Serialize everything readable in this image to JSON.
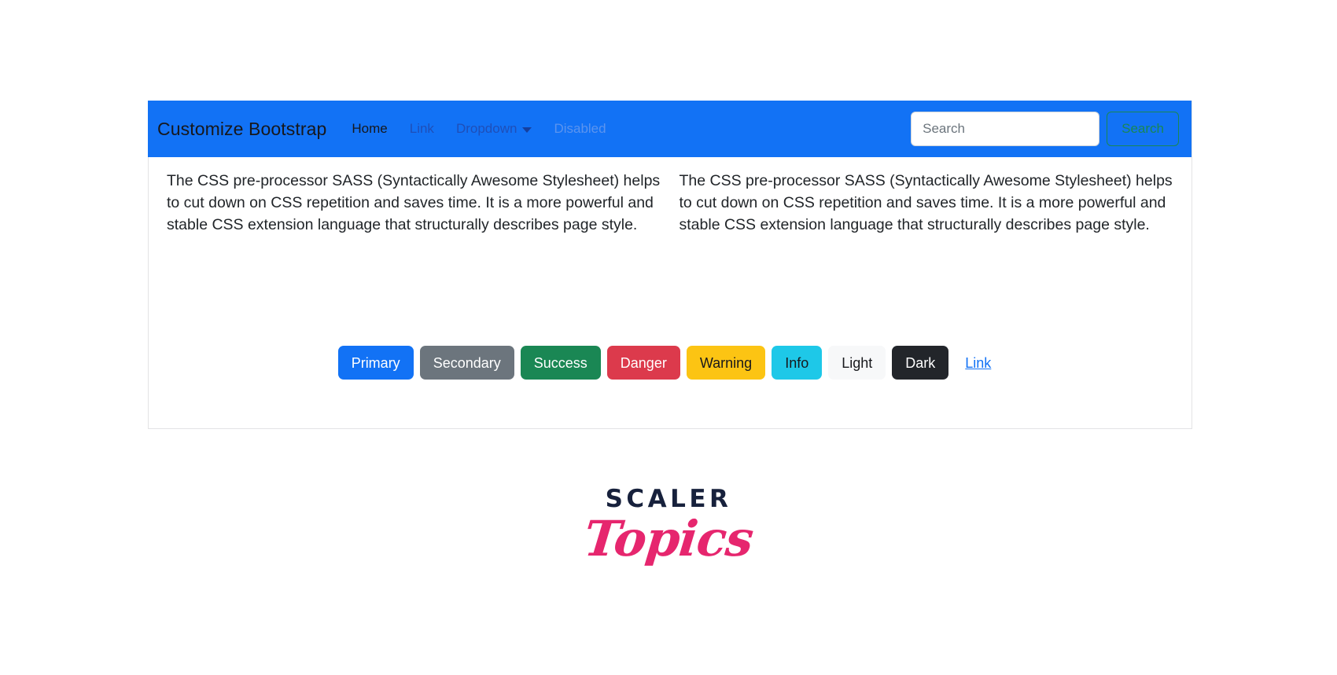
{
  "navbar": {
    "brand": "Customize Bootstrap",
    "background_color": "#1272f5",
    "links": [
      {
        "label": "Home",
        "state": "active"
      },
      {
        "label": "Link",
        "state": "default"
      },
      {
        "label": "Dropdown",
        "state": "dropdown"
      },
      {
        "label": "Disabled",
        "state": "disabled"
      }
    ],
    "dropdown_caret_icon": "caret-down-icon",
    "search": {
      "placeholder": "Search",
      "value": "",
      "button_label": "Search",
      "button_color": "#198754"
    }
  },
  "content": {
    "columns": [
      {
        "paragraph": "The CSS pre-processor SASS (Syntactically Awesome Stylesheet) helps to cut down on CSS repetition and saves time. It is a more powerful and stable CSS extension language that structurally describes page style."
      },
      {
        "paragraph": "The CSS pre-processor SASS (Syntactically Awesome Stylesheet) helps to cut down on CSS repetition and saves time. It is a more powerful and stable CSS extension language that structurally describes page style."
      }
    ],
    "buttons": [
      {
        "label": "Primary",
        "variant": "primary",
        "color": "#1272f5"
      },
      {
        "label": "Secondary",
        "variant": "secondary",
        "color": "#6c757d"
      },
      {
        "label": "Success",
        "variant": "success",
        "color": "#1a8754"
      },
      {
        "label": "Danger",
        "variant": "danger",
        "color": "#dc3a4c"
      },
      {
        "label": "Warning",
        "variant": "warning",
        "color": "#fcc413"
      },
      {
        "label": "Info",
        "variant": "info",
        "color": "#1ec8e8"
      },
      {
        "label": "Light",
        "variant": "light",
        "color": "#f7f8f9"
      },
      {
        "label": "Dark",
        "variant": "dark",
        "color": "#22252a"
      },
      {
        "label": "Link",
        "variant": "link",
        "color": "#1272f5"
      }
    ]
  },
  "logo": {
    "word": "SCALER",
    "script": "Topics",
    "word_color": "#17213c",
    "script_color": "#e6266e"
  }
}
